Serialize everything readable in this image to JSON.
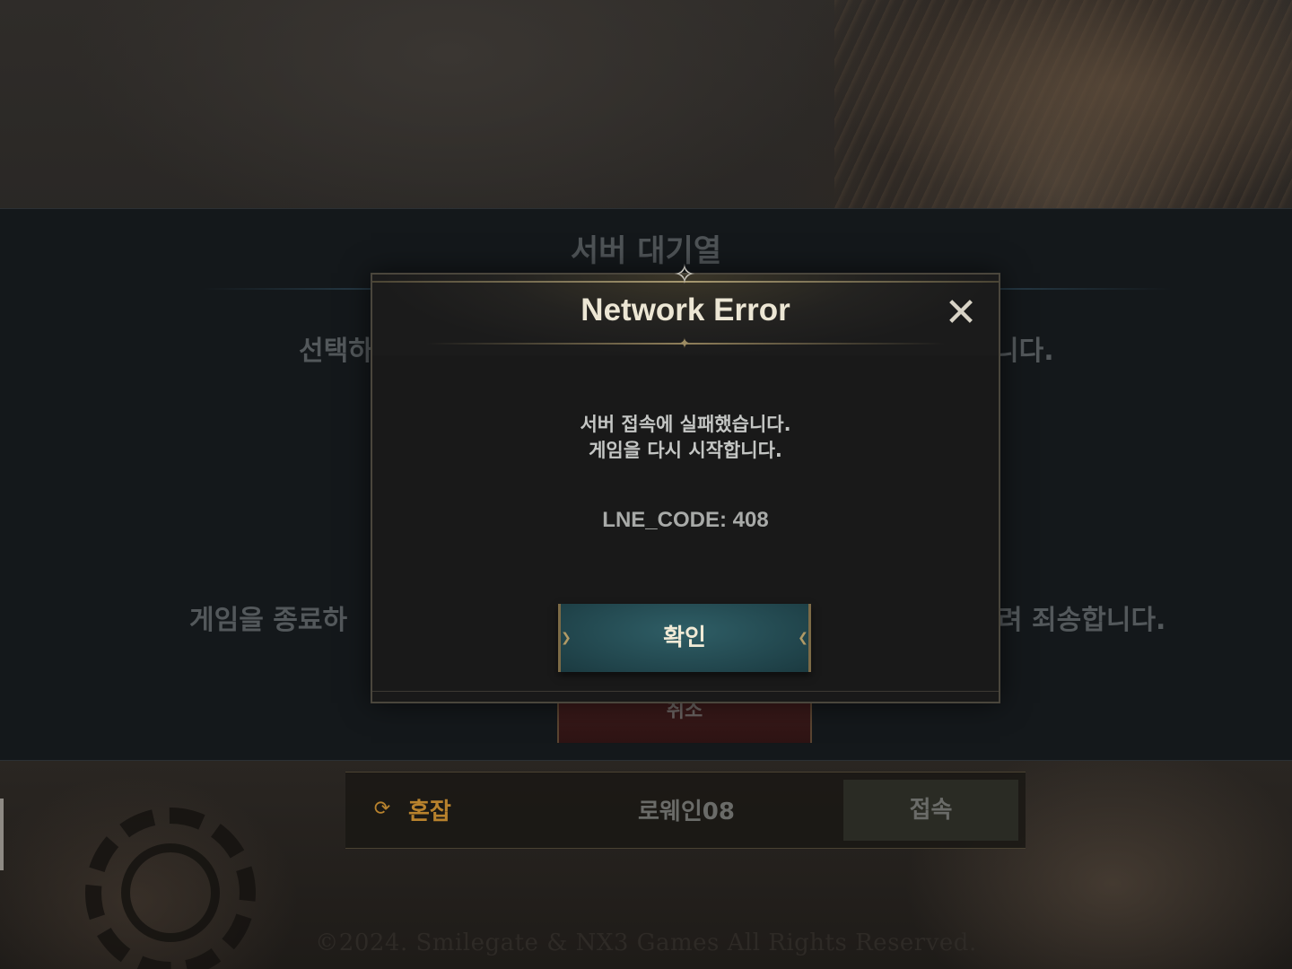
{
  "queue": {
    "title": "서버 대기열",
    "text_left_1": "선택하",
    "text_right_1": "니다.",
    "text_left_2": "게임을 종료하",
    "text_right_2": "려 죄송합니다.",
    "cancel_label": "취소"
  },
  "server": {
    "status_icon": "refresh-icon",
    "status_label": "혼잡",
    "status_color": "#b8822d",
    "name": "로웨인08",
    "connect_label": "접속"
  },
  "footer": {
    "copyright": "©2024. Smilegate & NX3 Games All Rights Reserved."
  },
  "dialog": {
    "title": "Network Error",
    "close_icon": "close-icon",
    "message_line1": "서버 접속에 실패했습니다.",
    "message_line2": "게임을 다시 시작합니다.",
    "error_code": "LNE_CODE: 408",
    "confirm_label": "확인",
    "confirm_color": "#21454c"
  }
}
